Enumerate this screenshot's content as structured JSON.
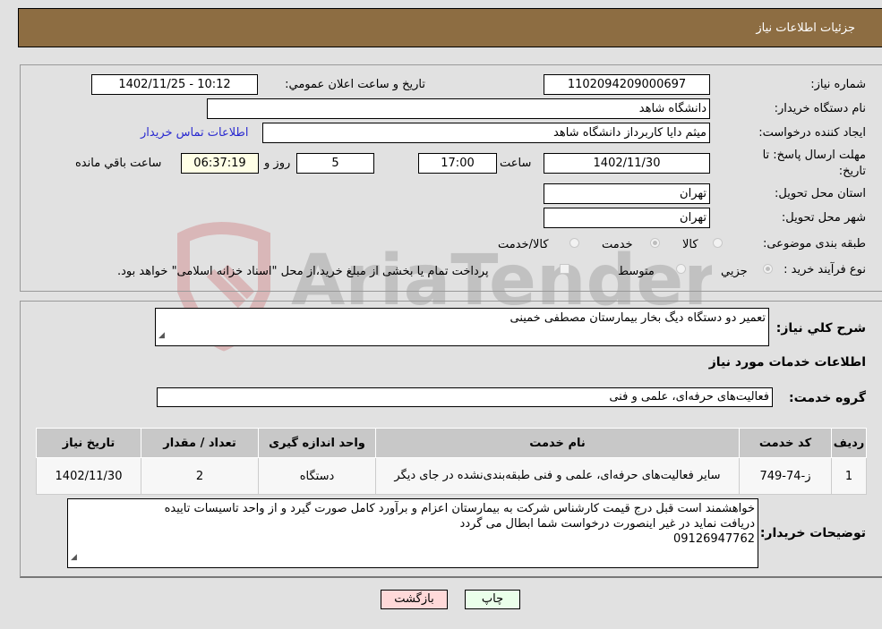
{
  "header": {
    "title": "جزئیات اطلاعات نیاز"
  },
  "form": {
    "need_number_label": "شماره نیاز:",
    "need_number": "1102094209000697",
    "announce_label": "تاریخ و ساعت اعلان عمومي:",
    "announce_value": "1402/11/25 - 10:12",
    "buyer_org_label": "نام دستگاه خریدار:",
    "buyer_org": "دانشگاه شاهد",
    "creator_label": "ایجاد کننده درخواست:",
    "creator": "میثم دایا کاربرداز دانشگاه شاهد",
    "buyer_contact_link": "اطلاعات تماس خریدار",
    "deadline_label": "مهلت ارسال پاسخ: تا تاریخ:",
    "deadline_date": "1402/11/30",
    "time_label": "ساعت",
    "deadline_time": "17:00",
    "days_value": "5",
    "days_label": "روز و",
    "remaining_time": "06:37:19",
    "remaining_label": "ساعت باقي مانده",
    "province_label": "استان محل تحویل:",
    "province": "تهران",
    "city_label": "شهر محل تحویل:",
    "city": "تهران",
    "category_label": "طبقه بندی موضوعی:",
    "category_options": [
      "کالا",
      "خدمت",
      "کالا/خدمت"
    ],
    "category_selected": "خدمت",
    "process_label": "نوع فرآیند خرید :",
    "process_options": [
      "جزيي",
      "متوسط"
    ],
    "process_selected": "جزيي",
    "treasury_note": "پرداخت تمام یا بخشی از مبلغ خرید،از محل \"اسناد خزانه اسلامی\" خواهد بود."
  },
  "details": {
    "summary_label": "شرح کلي نیاز:",
    "summary": "تعمیر دو دستگاه دیگ بخار بیمارستان مصطفی خمینی",
    "services_title": "اطلاعات خدمات مورد نیاز",
    "service_group_label": "گروه خدمت:",
    "service_group": "فعالیت‌های حرفه‌ای، علمی و فنی",
    "table": {
      "headers": [
        "ردیف",
        "کد خدمت",
        "نام خدمت",
        "واحد اندازه گیری",
        "تعداد / مقدار",
        "تاریخ نیاز"
      ],
      "rows": [
        [
          "1",
          "ز-74-749",
          "سایر فعالیت‌های حرفه‌ای، علمی و فنی طبقه‌بندی‌نشده در جای دیگر",
          "دستگاه",
          "2",
          "1402/11/30"
        ]
      ]
    },
    "buyer_notes_label": "توضیحات خریدار:",
    "buyer_notes_lines": [
      "خواهشمند است قبل درج قیمت کارشناس شرکت به بیمارستان اعزام و برآورد کامل صورت گیرد و از واحد تاسیسات تاییده",
      "دریافت نماید در غیر اینصورت درخواست شما ابطال می گردد",
      "09126947762"
    ]
  },
  "buttons": {
    "print": "چاپ",
    "back": "بازگشت"
  },
  "watermark": {
    "text": "AriaTender.neT"
  },
  "colors": {
    "header_bg": "#8d6d42",
    "back_btn": "#ffd9d9",
    "print_btn": "#eaffea",
    "timer_bg": "#ffffe6",
    "link": "#2a2ad0"
  }
}
